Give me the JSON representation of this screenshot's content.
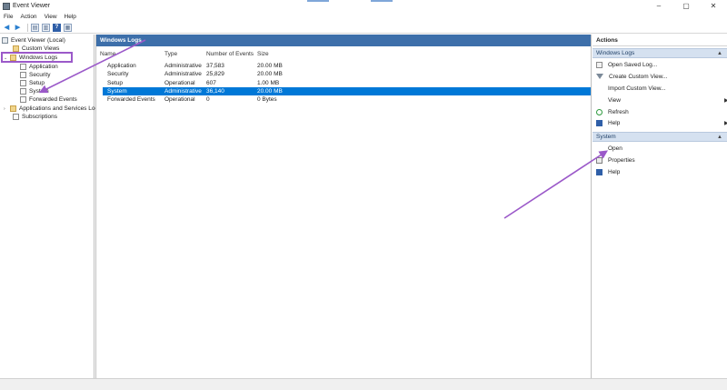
{
  "window": {
    "title": "Event Viewer"
  },
  "menu": [
    "File",
    "Action",
    "View",
    "Help"
  ],
  "tree": {
    "root": "Event Viewer (Local)",
    "custom_views": "Custom Views",
    "windows_logs": "Windows Logs",
    "children": [
      "Application",
      "Security",
      "Setup",
      "System",
      "Forwarded Events"
    ],
    "apps_services": "Applications and Services Logs",
    "subscriptions": "Subscriptions"
  },
  "center": {
    "header": "Windows Logs",
    "columns": [
      "Name",
      "Type",
      "Number of Events",
      "Size"
    ],
    "rows": [
      {
        "name": "Application",
        "type": "Administrative",
        "events": "37,583",
        "size": "20.00 MB"
      },
      {
        "name": "Security",
        "type": "Administrative",
        "events": "25,829",
        "size": "20.00 MB"
      },
      {
        "name": "Setup",
        "type": "Operational",
        "events": "607",
        "size": "1.00 MB"
      },
      {
        "name": "System",
        "type": "Administrative",
        "events": "36,140",
        "size": "20.00 MB"
      },
      {
        "name": "Forwarded Events",
        "type": "Operational",
        "events": "0",
        "size": "0 Bytes"
      }
    ],
    "selected_row": "System"
  },
  "actions": {
    "header": "Actions",
    "windows_logs_section": "Windows Logs",
    "windows_logs_items": [
      "Open Saved Log...",
      "Create Custom View...",
      "Import Custom View...",
      "View",
      "Refresh",
      "Help"
    ],
    "system_section": "System",
    "system_items": [
      "Open",
      "Properties",
      "Help"
    ]
  },
  "colors": {
    "pane_header": "#3d6faa",
    "selection": "#0078d7",
    "annotation": "#9b59c9",
    "section_header": "#d5e1f0"
  }
}
